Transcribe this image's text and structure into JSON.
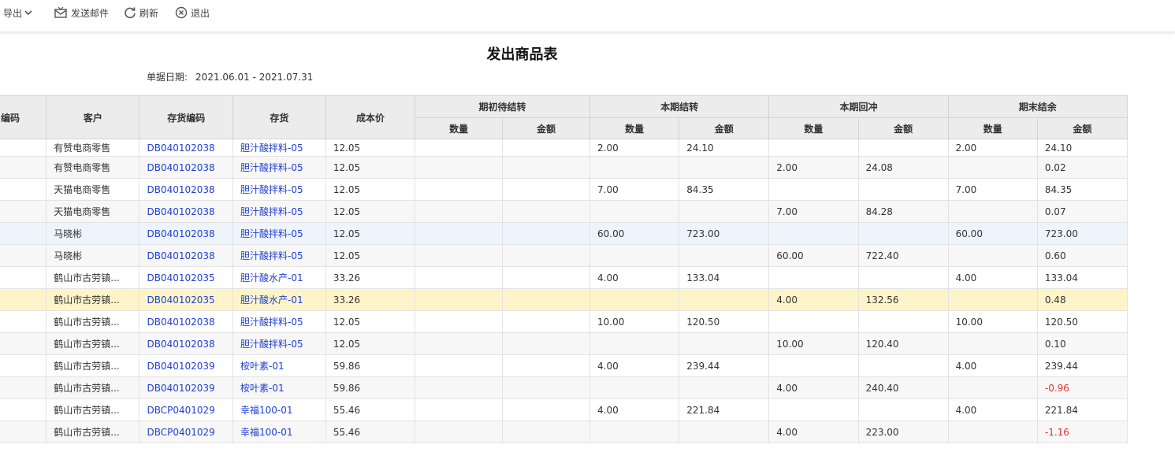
{
  "toolbar": {
    "export_label": "导出",
    "send_mail_label": "发送邮件",
    "refresh_label": "刷新",
    "exit_label": "退出"
  },
  "report": {
    "title": "发出商品表",
    "date_label": "单据日期:",
    "date_range": "2021.06.01 - 2021.07.31"
  },
  "table": {
    "headers": {
      "code": "编码",
      "customer": "客户",
      "item_code": "存货编码",
      "item": "存货",
      "cost": "成本价",
      "opening": "期初待结转",
      "current_transfer": "本期结转",
      "current_reversal": "本期回冲",
      "closing": "期末结余",
      "qty": "数量",
      "amount": "金额"
    },
    "rows": [
      {
        "customer": "有赞电商零售",
        "item_code": "DB040102038",
        "item": "胆汁酸拌料-05",
        "cost": "12.05",
        "oq": "",
        "oa": "",
        "tq": "2.00",
        "ta": "24.10",
        "rq": "",
        "ra": "",
        "cq": "2.00",
        "ca": "24.10"
      },
      {
        "customer": "有赞电商零售",
        "item_code": "DB040102038",
        "item": "胆汁酸拌料-05",
        "cost": "12.05",
        "oq": "",
        "oa": "",
        "tq": "",
        "ta": "",
        "rq": "2.00",
        "ra": "24.08",
        "cq": "",
        "ca": "0.02"
      },
      {
        "customer": "天猫电商零售",
        "item_code": "DB040102038",
        "item": "胆汁酸拌料-05",
        "cost": "12.05",
        "oq": "",
        "oa": "",
        "tq": "7.00",
        "ta": "84.35",
        "rq": "",
        "ra": "",
        "cq": "7.00",
        "ca": "84.35"
      },
      {
        "customer": "天猫电商零售",
        "item_code": "DB040102038",
        "item": "胆汁酸拌料-05",
        "cost": "12.05",
        "oq": "",
        "oa": "",
        "tq": "",
        "ta": "",
        "rq": "7.00",
        "ra": "84.28",
        "cq": "",
        "ca": "0.07"
      },
      {
        "customer": "马晓彬",
        "item_code": "DB040102038",
        "item": "胆汁酸拌料-05",
        "cost": "12.05",
        "oq": "",
        "oa": "",
        "tq": "60.00",
        "ta": "723.00",
        "rq": "",
        "ra": "",
        "cq": "60.00",
        "ca": "723.00"
      },
      {
        "customer": "马晓彬",
        "item_code": "DB040102038",
        "item": "胆汁酸拌料-05",
        "cost": "12.05",
        "oq": "",
        "oa": "",
        "tq": "",
        "ta": "",
        "rq": "60.00",
        "ra": "722.40",
        "cq": "",
        "ca": "0.60"
      },
      {
        "customer": "鹤山市古劳镇...",
        "item_code": "DB040102035",
        "item": "胆汁酸水产-01",
        "cost": "33.26",
        "oq": "",
        "oa": "",
        "tq": "4.00",
        "ta": "133.04",
        "rq": "",
        "ra": "",
        "cq": "4.00",
        "ca": "133.04"
      },
      {
        "customer": "鹤山市古劳镇...",
        "item_code": "DB040102035",
        "item": "胆汁酸水产-01",
        "cost": "33.26",
        "oq": "",
        "oa": "",
        "tq": "",
        "ta": "",
        "rq": "4.00",
        "ra": "132.56",
        "cq": "",
        "ca": "0.48"
      },
      {
        "customer": "鹤山市古劳镇...",
        "item_code": "DB040102038",
        "item": "胆汁酸拌料-05",
        "cost": "12.05",
        "oq": "",
        "oa": "",
        "tq": "10.00",
        "ta": "120.50",
        "rq": "",
        "ra": "",
        "cq": "10.00",
        "ca": "120.50"
      },
      {
        "customer": "鹤山市古劳镇...",
        "item_code": "DB040102038",
        "item": "胆汁酸拌料-05",
        "cost": "12.05",
        "oq": "",
        "oa": "",
        "tq": "",
        "ta": "",
        "rq": "10.00",
        "ra": "120.40",
        "cq": "",
        "ca": "0.10"
      },
      {
        "customer": "鹤山市古劳镇...",
        "item_code": "DB040102039",
        "item": "桉叶素-01",
        "cost": "59.86",
        "oq": "",
        "oa": "",
        "tq": "4.00",
        "ta": "239.44",
        "rq": "",
        "ra": "",
        "cq": "4.00",
        "ca": "239.44"
      },
      {
        "customer": "鹤山市古劳镇...",
        "item_code": "DB040102039",
        "item": "桉叶素-01",
        "cost": "59.86",
        "oq": "",
        "oa": "",
        "tq": "",
        "ta": "",
        "rq": "4.00",
        "ra": "240.40",
        "cq": "",
        "ca": "-0.96"
      },
      {
        "customer": "鹤山市古劳镇...",
        "item_code": "DBCP0401029",
        "item": "幸福100-01",
        "cost": "55.46",
        "oq": "",
        "oa": "",
        "tq": "4.00",
        "ta": "221.84",
        "rq": "",
        "ra": "",
        "cq": "4.00",
        "ca": "221.84"
      },
      {
        "customer": "鹤山市古劳镇...",
        "item_code": "DBCP0401029",
        "item": "幸福100-01",
        "cost": "55.46",
        "oq": "",
        "oa": "",
        "tq": "",
        "ta": "",
        "rq": "4.00",
        "ra": "223.00",
        "cq": "",
        "ca": "-1.16"
      }
    ]
  },
  "colors": {
    "link": "#1f3fd4",
    "negative": "#e53030",
    "selected_row": "#eef4fc",
    "highlight_row": "#fdf5c9",
    "header_bg": "#ececec"
  }
}
